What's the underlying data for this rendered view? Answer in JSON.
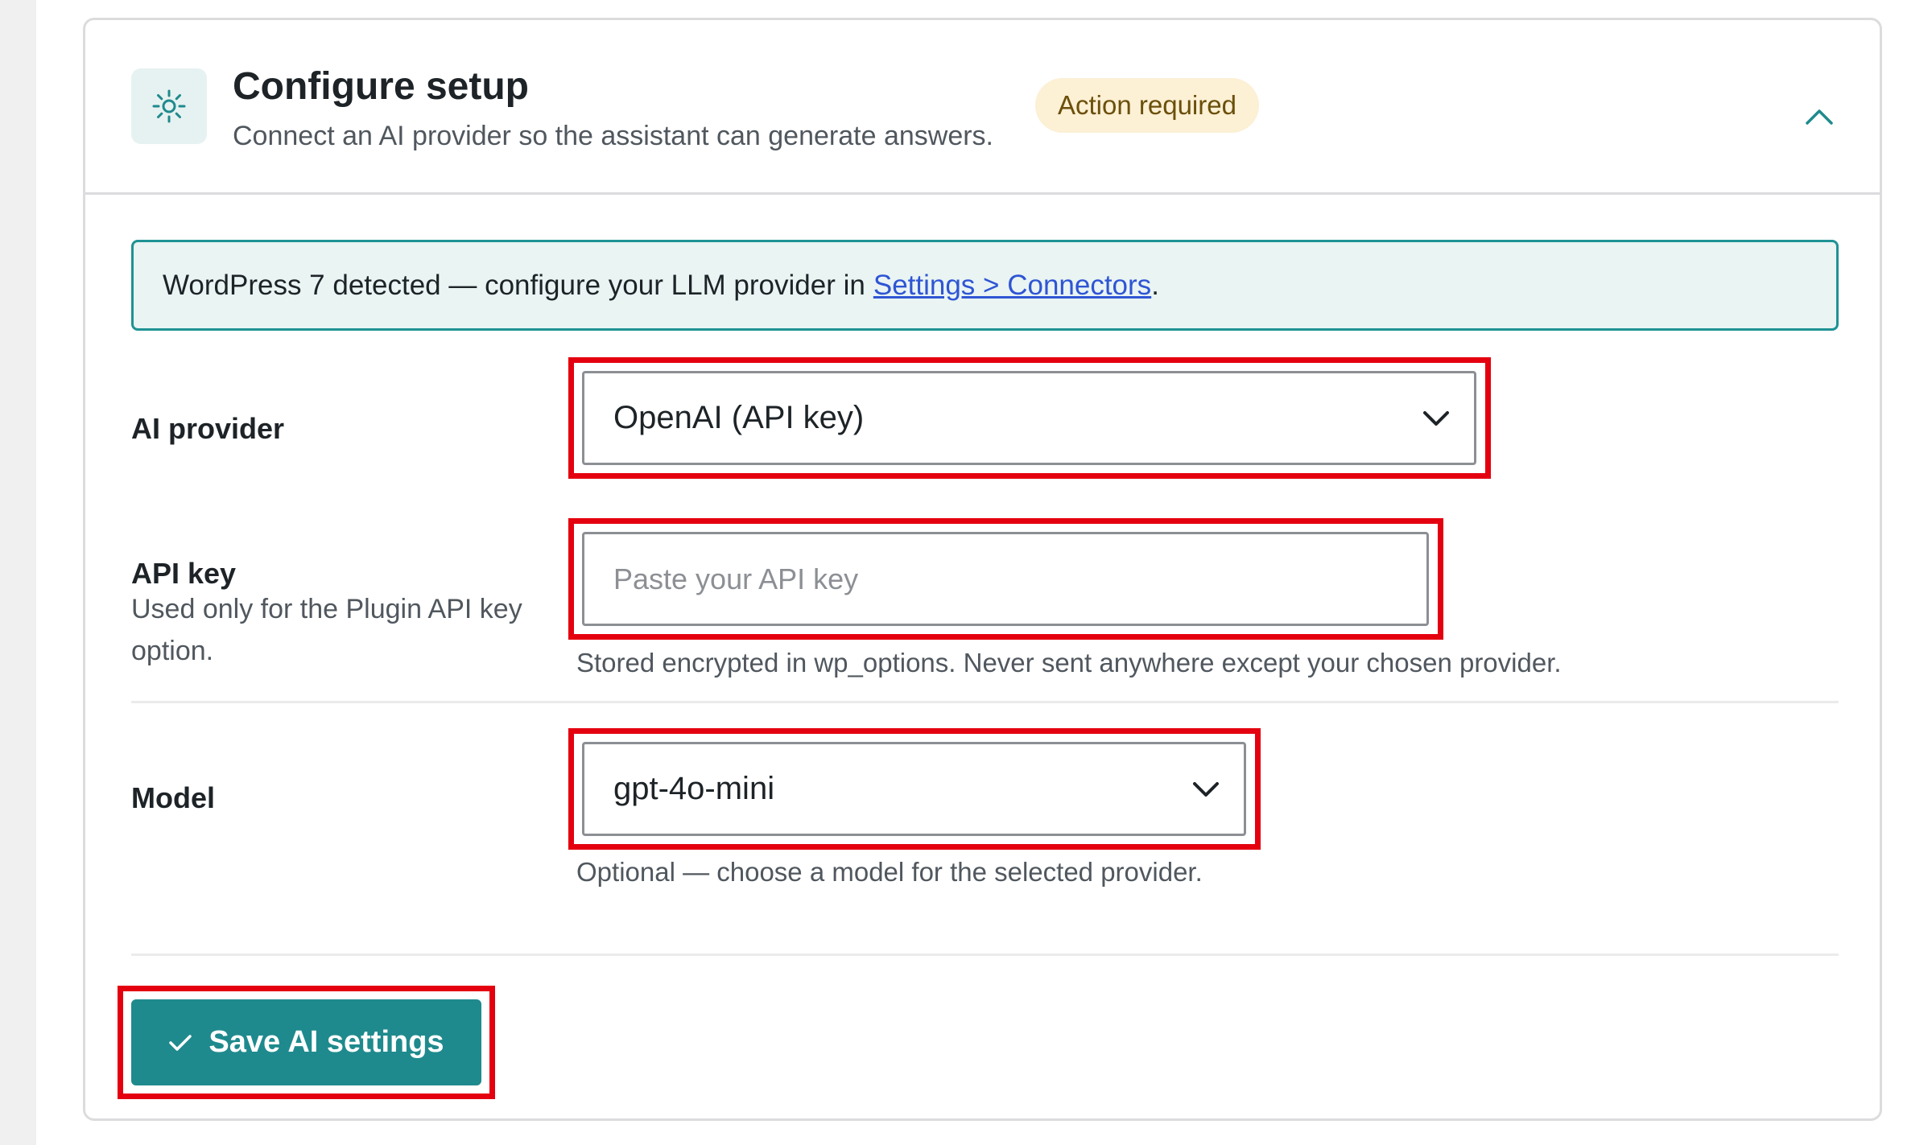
{
  "card": {
    "title": "Configure setup",
    "subtitle": "Connect an AI provider so the assistant can generate answers.",
    "badge": "Action required",
    "icon": "gear-sun-icon",
    "collapse_icon": "chevron-up-icon"
  },
  "notice": {
    "text": "WordPress 7 detected — configure your LLM provider in",
    "link_text": "Settings > Connectors",
    "suffix": "."
  },
  "fields": {
    "ai_provider": {
      "label": "AI provider",
      "value": "OpenAI (API key)"
    },
    "api_key": {
      "label": "API key",
      "description": "Used only for the Plugin API key option.",
      "placeholder": "Paste your API key",
      "value": "",
      "help": "Stored encrypted in wp_options. Never sent anywhere except your chosen provider."
    },
    "model": {
      "label": "Model",
      "value": "gpt-4o-mini",
      "help": "Optional — choose a model for the selected provider."
    }
  },
  "actions": {
    "save_label": "Save AI settings"
  },
  "colors": {
    "accent": "#1f8a8d",
    "highlight": "#e4000f",
    "badge_bg": "#fcf0d5",
    "notice_bg": "#e9f4f3",
    "link": "#2f55d4"
  }
}
